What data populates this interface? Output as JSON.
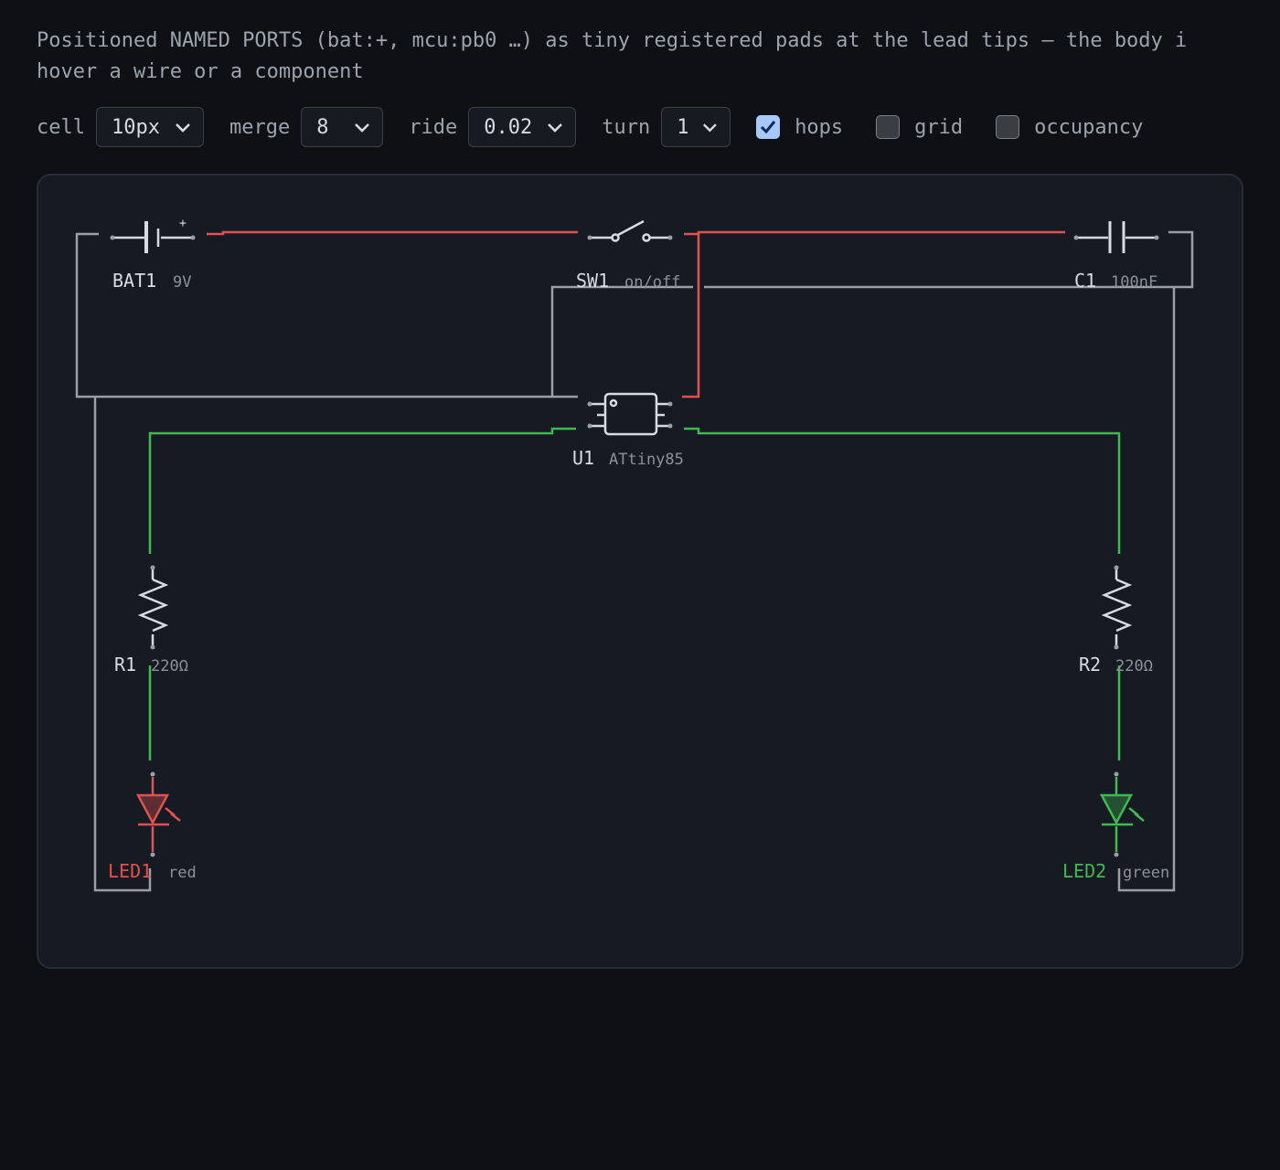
{
  "description": {
    "line1": "Positioned NAMED PORTS (bat:+, mcu:pb0 …) as tiny registered pads at the lead tips — the body i",
    "line2": "hover a wire or a component"
  },
  "controls": {
    "cell": {
      "label": "cell",
      "value": "10px"
    },
    "merge": {
      "label": "merge",
      "value": "8"
    },
    "ride": {
      "label": "ride",
      "value": "0.02"
    },
    "turn": {
      "label": "turn",
      "value": "1"
    },
    "hops": {
      "label": "hops",
      "checked": true
    },
    "grid": {
      "label": "grid",
      "checked": false
    },
    "occupancy": {
      "label": "occupancy",
      "checked": false
    }
  },
  "colors": {
    "wire_power": "#e05252",
    "wire_signal": "#3fb950",
    "wire_ground": "#9aa0a8",
    "component": "#d8dce2",
    "led_red": "#e05252",
    "led_green": "#3fb950"
  },
  "components": {
    "bat1": {
      "ref": "BAT1",
      "value": "9V",
      "polarity": "+"
    },
    "sw1": {
      "ref": "SW1",
      "value": "on/off"
    },
    "c1": {
      "ref": "C1",
      "value": "100nF"
    },
    "u1": {
      "ref": "U1",
      "value": "ATtiny85"
    },
    "r1": {
      "ref": "R1",
      "value": "220Ω"
    },
    "r2": {
      "ref": "R2",
      "value": "220Ω"
    },
    "led1": {
      "ref": "LED1",
      "value": "red"
    },
    "led2": {
      "ref": "LED2",
      "value": "green"
    }
  }
}
